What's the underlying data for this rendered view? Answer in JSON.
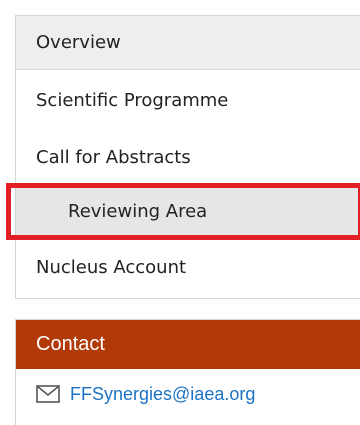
{
  "nav": {
    "items": [
      {
        "label": "Overview"
      },
      {
        "label": "Scientific Programme"
      },
      {
        "label": "Call for Abstracts"
      },
      {
        "label": "Reviewing Area"
      },
      {
        "label": "Nucleus Account"
      }
    ]
  },
  "contact": {
    "title": "Contact",
    "email": "FFSynergies@iaea.org",
    "icon": "mail-icon"
  },
  "colors": {
    "contact_header_bg": "#b23a09",
    "highlight_border": "#e31e24",
    "link": "#1a73c4"
  }
}
